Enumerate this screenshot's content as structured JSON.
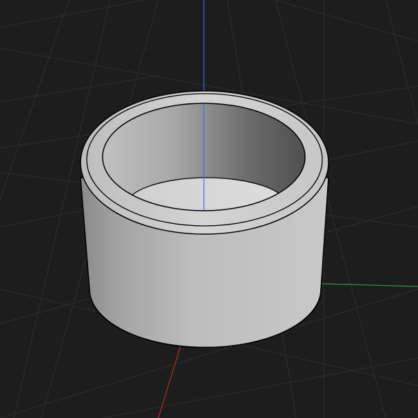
{
  "viewport": {
    "type": "3d-viewport",
    "background_color": "#1d1d1d",
    "grid_color": "#2e2e2e",
    "axes": {
      "x_axis_color": "#b03030",
      "y_axis_color": "#2f9b3a",
      "z_axis_color": "#3f6fd6"
    },
    "object": {
      "shape": "hollow cylinder (ring) with chamfered top edge",
      "color": "#b6b6b6",
      "outline_color": "#000000"
    }
  }
}
